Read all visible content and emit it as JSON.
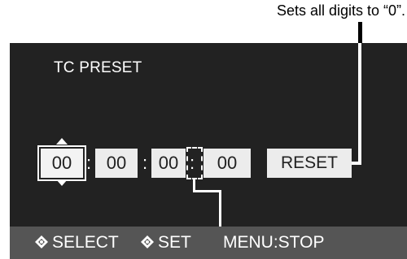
{
  "callout": {
    "text": "Sets all digits to “0”."
  },
  "screen": {
    "title": "TC PRESET",
    "timecode": {
      "hours": "00",
      "minutes": "00",
      "seconds": "00",
      "frames": "00",
      "separator": ":",
      "frame_separator": ":"
    },
    "reset_label": "RESET"
  },
  "bottom_bar": {
    "select_label": "SELECT",
    "set_label": "SET",
    "menu_label": "MENU:STOP",
    "icon": "dpad-icon"
  },
  "colors": {
    "screen_bg": "#222222",
    "bar_bg": "#555555",
    "field_bg": "#ececec",
    "text_light": "#ffffff"
  }
}
